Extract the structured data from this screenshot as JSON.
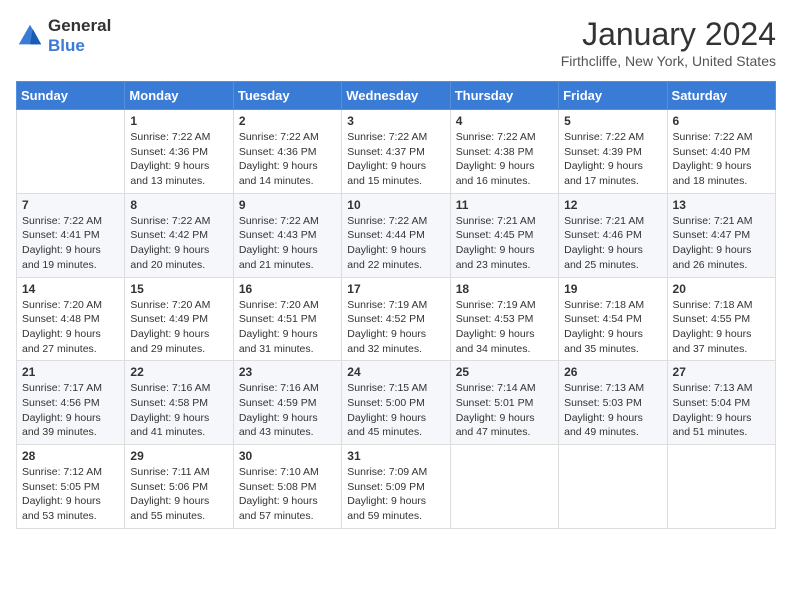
{
  "header": {
    "logo": {
      "general": "General",
      "blue": "Blue"
    },
    "title": "January 2024",
    "subtitle": "Firthcliffe, New York, United States"
  },
  "weekdays": [
    "Sunday",
    "Monday",
    "Tuesday",
    "Wednesday",
    "Thursday",
    "Friday",
    "Saturday"
  ],
  "weeks": [
    [
      {
        "day": "",
        "sunrise": "",
        "sunset": "",
        "daylight": ""
      },
      {
        "day": "1",
        "sunrise": "Sunrise: 7:22 AM",
        "sunset": "Sunset: 4:36 PM",
        "daylight": "Daylight: 9 hours and 13 minutes."
      },
      {
        "day": "2",
        "sunrise": "Sunrise: 7:22 AM",
        "sunset": "Sunset: 4:36 PM",
        "daylight": "Daylight: 9 hours and 14 minutes."
      },
      {
        "day": "3",
        "sunrise": "Sunrise: 7:22 AM",
        "sunset": "Sunset: 4:37 PM",
        "daylight": "Daylight: 9 hours and 15 minutes."
      },
      {
        "day": "4",
        "sunrise": "Sunrise: 7:22 AM",
        "sunset": "Sunset: 4:38 PM",
        "daylight": "Daylight: 9 hours and 16 minutes."
      },
      {
        "day": "5",
        "sunrise": "Sunrise: 7:22 AM",
        "sunset": "Sunset: 4:39 PM",
        "daylight": "Daylight: 9 hours and 17 minutes."
      },
      {
        "day": "6",
        "sunrise": "Sunrise: 7:22 AM",
        "sunset": "Sunset: 4:40 PM",
        "daylight": "Daylight: 9 hours and 18 minutes."
      }
    ],
    [
      {
        "day": "7",
        "sunrise": "Sunrise: 7:22 AM",
        "sunset": "Sunset: 4:41 PM",
        "daylight": "Daylight: 9 hours and 19 minutes."
      },
      {
        "day": "8",
        "sunrise": "Sunrise: 7:22 AM",
        "sunset": "Sunset: 4:42 PM",
        "daylight": "Daylight: 9 hours and 20 minutes."
      },
      {
        "day": "9",
        "sunrise": "Sunrise: 7:22 AM",
        "sunset": "Sunset: 4:43 PM",
        "daylight": "Daylight: 9 hours and 21 minutes."
      },
      {
        "day": "10",
        "sunrise": "Sunrise: 7:22 AM",
        "sunset": "Sunset: 4:44 PM",
        "daylight": "Daylight: 9 hours and 22 minutes."
      },
      {
        "day": "11",
        "sunrise": "Sunrise: 7:21 AM",
        "sunset": "Sunset: 4:45 PM",
        "daylight": "Daylight: 9 hours and 23 minutes."
      },
      {
        "day": "12",
        "sunrise": "Sunrise: 7:21 AM",
        "sunset": "Sunset: 4:46 PM",
        "daylight": "Daylight: 9 hours and 25 minutes."
      },
      {
        "day": "13",
        "sunrise": "Sunrise: 7:21 AM",
        "sunset": "Sunset: 4:47 PM",
        "daylight": "Daylight: 9 hours and 26 minutes."
      }
    ],
    [
      {
        "day": "14",
        "sunrise": "Sunrise: 7:20 AM",
        "sunset": "Sunset: 4:48 PM",
        "daylight": "Daylight: 9 hours and 27 minutes."
      },
      {
        "day": "15",
        "sunrise": "Sunrise: 7:20 AM",
        "sunset": "Sunset: 4:49 PM",
        "daylight": "Daylight: 9 hours and 29 minutes."
      },
      {
        "day": "16",
        "sunrise": "Sunrise: 7:20 AM",
        "sunset": "Sunset: 4:51 PM",
        "daylight": "Daylight: 9 hours and 31 minutes."
      },
      {
        "day": "17",
        "sunrise": "Sunrise: 7:19 AM",
        "sunset": "Sunset: 4:52 PM",
        "daylight": "Daylight: 9 hours and 32 minutes."
      },
      {
        "day": "18",
        "sunrise": "Sunrise: 7:19 AM",
        "sunset": "Sunset: 4:53 PM",
        "daylight": "Daylight: 9 hours and 34 minutes."
      },
      {
        "day": "19",
        "sunrise": "Sunrise: 7:18 AM",
        "sunset": "Sunset: 4:54 PM",
        "daylight": "Daylight: 9 hours and 35 minutes."
      },
      {
        "day": "20",
        "sunrise": "Sunrise: 7:18 AM",
        "sunset": "Sunset: 4:55 PM",
        "daylight": "Daylight: 9 hours and 37 minutes."
      }
    ],
    [
      {
        "day": "21",
        "sunrise": "Sunrise: 7:17 AM",
        "sunset": "Sunset: 4:56 PM",
        "daylight": "Daylight: 9 hours and 39 minutes."
      },
      {
        "day": "22",
        "sunrise": "Sunrise: 7:16 AM",
        "sunset": "Sunset: 4:58 PM",
        "daylight": "Daylight: 9 hours and 41 minutes."
      },
      {
        "day": "23",
        "sunrise": "Sunrise: 7:16 AM",
        "sunset": "Sunset: 4:59 PM",
        "daylight": "Daylight: 9 hours and 43 minutes."
      },
      {
        "day": "24",
        "sunrise": "Sunrise: 7:15 AM",
        "sunset": "Sunset: 5:00 PM",
        "daylight": "Daylight: 9 hours and 45 minutes."
      },
      {
        "day": "25",
        "sunrise": "Sunrise: 7:14 AM",
        "sunset": "Sunset: 5:01 PM",
        "daylight": "Daylight: 9 hours and 47 minutes."
      },
      {
        "day": "26",
        "sunrise": "Sunrise: 7:13 AM",
        "sunset": "Sunset: 5:03 PM",
        "daylight": "Daylight: 9 hours and 49 minutes."
      },
      {
        "day": "27",
        "sunrise": "Sunrise: 7:13 AM",
        "sunset": "Sunset: 5:04 PM",
        "daylight": "Daylight: 9 hours and 51 minutes."
      }
    ],
    [
      {
        "day": "28",
        "sunrise": "Sunrise: 7:12 AM",
        "sunset": "Sunset: 5:05 PM",
        "daylight": "Daylight: 9 hours and 53 minutes."
      },
      {
        "day": "29",
        "sunrise": "Sunrise: 7:11 AM",
        "sunset": "Sunset: 5:06 PM",
        "daylight": "Daylight: 9 hours and 55 minutes."
      },
      {
        "day": "30",
        "sunrise": "Sunrise: 7:10 AM",
        "sunset": "Sunset: 5:08 PM",
        "daylight": "Daylight: 9 hours and 57 minutes."
      },
      {
        "day": "31",
        "sunrise": "Sunrise: 7:09 AM",
        "sunset": "Sunset: 5:09 PM",
        "daylight": "Daylight: 9 hours and 59 minutes."
      },
      {
        "day": "",
        "sunrise": "",
        "sunset": "",
        "daylight": ""
      },
      {
        "day": "",
        "sunrise": "",
        "sunset": "",
        "daylight": ""
      },
      {
        "day": "",
        "sunrise": "",
        "sunset": "",
        "daylight": ""
      }
    ]
  ]
}
